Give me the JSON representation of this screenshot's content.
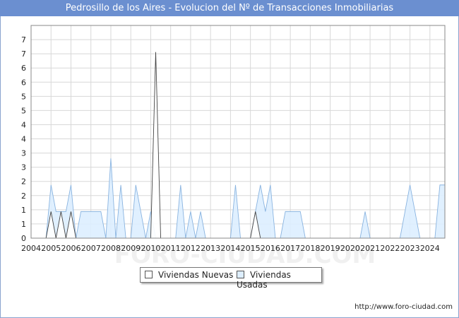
{
  "title": "Pedrosillo de los Aires - Evolucion del Nº de Transacciones Inmobiliarias",
  "watermark": "FORO-CIUDAD.COM",
  "footer_url": "http://www.foro-ciudad.com",
  "legend": [
    {
      "label": "Viviendas Nuevas",
      "color": "#ffffff"
    },
    {
      "label": "Viviendas Usadas",
      "color": "#ddeeff"
    }
  ],
  "chart_data": {
    "type": "area",
    "title": "Pedrosillo de los Aires - Evolucion del Nº de Transacciones Inmobiliarias",
    "xlabel": "",
    "ylabel": "",
    "xlim": [
      2004,
      2024.75
    ],
    "ylim": [
      0,
      8
    ],
    "x_tick_labels": [
      "2004",
      "2005",
      "2006",
      "2007",
      "2008",
      "2009",
      "2010",
      "2011",
      "2012",
      "2013",
      "2014",
      "2015",
      "2016",
      "2017",
      "2018",
      "2019",
      "2020",
      "2021",
      "2022",
      "2023",
      "2024"
    ],
    "y_tick_labels": [
      "0",
      "1",
      "1",
      "2",
      "2",
      "3",
      "3",
      "4",
      "4",
      "5",
      "5",
      "6",
      "6",
      "7",
      "7"
    ],
    "grid": true,
    "legend_position": "bottom",
    "series": [
      {
        "name": "Viviendas Usadas",
        "color": "#ddeeff",
        "stroke": "#8ab4e0",
        "points": [
          [
            2004,
            0
          ],
          [
            2004.75,
            0
          ],
          [
            2005,
            2
          ],
          [
            2005.25,
            1
          ],
          [
            2005.5,
            1
          ],
          [
            2005.75,
            1
          ],
          [
            2006,
            2
          ],
          [
            2006.25,
            0
          ],
          [
            2006.5,
            1
          ],
          [
            2006.75,
            1
          ],
          [
            2007,
            1
          ],
          [
            2007.25,
            1
          ],
          [
            2007.5,
            1
          ],
          [
            2007.75,
            0
          ],
          [
            2008,
            3
          ],
          [
            2008.25,
            0
          ],
          [
            2008.5,
            2
          ],
          [
            2008.75,
            0
          ],
          [
            2009,
            0
          ],
          [
            2009.25,
            2
          ],
          [
            2009.5,
            1
          ],
          [
            2009.75,
            0
          ],
          [
            2010,
            1
          ],
          [
            2010.25,
            0
          ],
          [
            2010.5,
            0
          ],
          [
            2010.75,
            0
          ],
          [
            2011,
            0
          ],
          [
            2011.25,
            0
          ],
          [
            2011.5,
            2
          ],
          [
            2011.75,
            0
          ],
          [
            2012,
            1
          ],
          [
            2012.25,
            0
          ],
          [
            2012.5,
            1
          ],
          [
            2012.75,
            0
          ],
          [
            2013,
            0
          ],
          [
            2013.25,
            0
          ],
          [
            2013.5,
            0
          ],
          [
            2013.75,
            0
          ],
          [
            2014,
            0
          ],
          [
            2014.25,
            2
          ],
          [
            2014.5,
            0
          ],
          [
            2014.75,
            0
          ],
          [
            2015,
            0
          ],
          [
            2015.25,
            1
          ],
          [
            2015.5,
            2
          ],
          [
            2015.75,
            1
          ],
          [
            2016,
            2
          ],
          [
            2016.25,
            0
          ],
          [
            2016.5,
            0
          ],
          [
            2016.75,
            1
          ],
          [
            2017,
            1
          ],
          [
            2017.25,
            1
          ],
          [
            2017.5,
            1
          ],
          [
            2017.75,
            0
          ],
          [
            2018,
            0
          ],
          [
            2018.25,
            0
          ],
          [
            2018.5,
            0
          ],
          [
            2018.75,
            0
          ],
          [
            2019,
            0
          ],
          [
            2019.25,
            0
          ],
          [
            2019.5,
            0
          ],
          [
            2019.75,
            0
          ],
          [
            2020,
            0
          ],
          [
            2020.25,
            0
          ],
          [
            2020.5,
            0
          ],
          [
            2020.75,
            1
          ],
          [
            2021,
            0
          ],
          [
            2021.25,
            0
          ],
          [
            2021.5,
            0
          ],
          [
            2021.75,
            0
          ],
          [
            2022,
            0
          ],
          [
            2022.25,
            0
          ],
          [
            2022.5,
            0
          ],
          [
            2022.75,
            1
          ],
          [
            2023,
            2
          ],
          [
            2023.25,
            1
          ],
          [
            2023.5,
            0
          ],
          [
            2023.75,
            0
          ],
          [
            2024,
            0
          ],
          [
            2024.25,
            0
          ],
          [
            2024.5,
            2
          ],
          [
            2024.75,
            2
          ]
        ]
      },
      {
        "name": "Viviendas Nuevas",
        "color": "#ffffff",
        "stroke": "#444444",
        "points": [
          [
            2004,
            0
          ],
          [
            2004.75,
            0
          ],
          [
            2005,
            1
          ],
          [
            2005.25,
            0
          ],
          [
            2005.5,
            1
          ],
          [
            2005.75,
            0
          ],
          [
            2006,
            1
          ],
          [
            2006.25,
            0
          ],
          [
            2006.5,
            0
          ],
          [
            2006.75,
            0
          ],
          [
            2007,
            0
          ],
          [
            2007.25,
            0
          ],
          [
            2007.5,
            0
          ],
          [
            2007.75,
            0
          ],
          [
            2008,
            0
          ],
          [
            2008.25,
            0
          ],
          [
            2008.5,
            0
          ],
          [
            2008.75,
            0
          ],
          [
            2009,
            0
          ],
          [
            2009.25,
            0
          ],
          [
            2009.5,
            0
          ],
          [
            2009.75,
            0
          ],
          [
            2010,
            0
          ],
          [
            2010.25,
            7
          ],
          [
            2010.5,
            0
          ],
          [
            2010.75,
            0
          ],
          [
            2011,
            0
          ],
          [
            2011.25,
            0
          ],
          [
            2011.5,
            0
          ],
          [
            2011.75,
            0
          ],
          [
            2012,
            0
          ],
          [
            2012.25,
            0
          ],
          [
            2012.5,
            0
          ],
          [
            2012.75,
            0
          ],
          [
            2013,
            0
          ],
          [
            2013.25,
            0
          ],
          [
            2013.5,
            0
          ],
          [
            2013.75,
            0
          ],
          [
            2014,
            0
          ],
          [
            2014.25,
            0
          ],
          [
            2014.5,
            0
          ],
          [
            2014.75,
            0
          ],
          [
            2015,
            0
          ],
          [
            2015.25,
            1
          ],
          [
            2015.5,
            0
          ],
          [
            2015.75,
            0
          ],
          [
            2016,
            0
          ],
          [
            2016.25,
            0
          ],
          [
            2016.5,
            0
          ],
          [
            2016.75,
            0
          ],
          [
            2017,
            0
          ],
          [
            2017.25,
            0
          ],
          [
            2017.5,
            0
          ],
          [
            2017.75,
            0
          ],
          [
            2018,
            0
          ],
          [
            2018.25,
            0
          ],
          [
            2018.5,
            0
          ],
          [
            2018.75,
            0
          ],
          [
            2019,
            0
          ],
          [
            2019.25,
            0
          ],
          [
            2019.5,
            0
          ],
          [
            2019.75,
            0
          ],
          [
            2020,
            0
          ],
          [
            2020.25,
            0
          ],
          [
            2020.5,
            0
          ],
          [
            2020.75,
            0
          ],
          [
            2021,
            0
          ],
          [
            2021.25,
            0
          ],
          [
            2021.5,
            0
          ],
          [
            2021.75,
            0
          ],
          [
            2022,
            0
          ],
          [
            2022.25,
            0
          ],
          [
            2022.5,
            0
          ],
          [
            2022.75,
            0
          ],
          [
            2023,
            0
          ],
          [
            2023.25,
            0
          ],
          [
            2023.5,
            0
          ],
          [
            2023.75,
            0
          ],
          [
            2024,
            0
          ],
          [
            2024.25,
            0
          ],
          [
            2024.5,
            0
          ],
          [
            2024.75,
            0
          ]
        ]
      }
    ]
  }
}
